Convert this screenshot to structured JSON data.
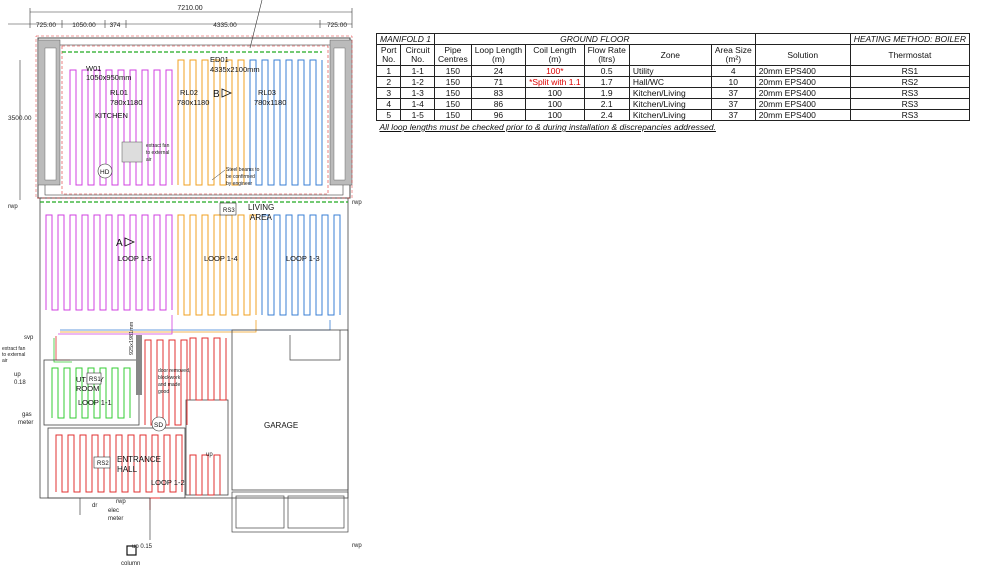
{
  "plan": {
    "dims": {
      "total_width": "7210.00",
      "left": "725.00",
      "seg1": "1050.00",
      "seg2": "374",
      "middle": "4335.00",
      "right": "725.00",
      "height": "3500.00"
    },
    "openings": {
      "w01_code": "W01",
      "w01_size": "1050x950mm",
      "ed01_code": "ED01",
      "ed01_size": "4335x2100mm",
      "rl01_code": "RL01",
      "rl01_size": "780x1180",
      "rl02_code": "RL02",
      "rl02_size": "780x1180",
      "rl03_code": "RL03",
      "rl03_size": "780x1180"
    },
    "labels": {
      "kitchen": "KITCHEN",
      "living": "LIVING",
      "area": "AREA",
      "utility": "UTILITY",
      "room": "ROOM",
      "entrance": "ENTRANCE",
      "hall": "HALL",
      "garage": "GARAGE",
      "loop_1_5": "LOOP 1-5",
      "loop_1_4": "LOOP 1-4",
      "loop_1_3": "LOOP 1-3",
      "loop_1_1": "LOOP 1-1",
      "loop_1_2": "LOOP 1-2",
      "rs1": "RS1",
      "rs2": "RS2",
      "rs3": "RS3",
      "hd": "HD",
      "sd": "SD",
      "section_a": "A",
      "section_b": "B",
      "rwp": "rwp",
      "svp": "svp",
      "gas": "gas",
      "meter": "meter",
      "up": "up",
      "up_val": "0.18",
      "up_015": "up 0.15",
      "dr": "dr",
      "elec": "elec",
      "elec_meter": "meter",
      "column": "column",
      "stair_up": "up",
      "extract_fan1": "extract fan",
      "extract_fan2": "to external",
      "extract_fan3": "air",
      "extract_fan_b1": "extract fan",
      "extract_fan_b2": "to external",
      "extract_fan_b3": "air",
      "steel1": "Steel beams to",
      "steel2": "be confirmed",
      "steel3": "by engineer",
      "door1": "door removed,",
      "door2": "blockwork",
      "door3": "and made",
      "door4": "good",
      "dim_vertical": "925x1981mm"
    }
  },
  "table": {
    "manifold": "MANIFOLD 1",
    "ground_floor": "GROUND FLOOR",
    "heating_method": "HEATING METHOD: BOILER",
    "headers": {
      "port": "Port",
      "port2": "No.",
      "circuit": "Circuit",
      "circuit2": "No.",
      "pipe": "Pipe",
      "pipe2": "Centres",
      "loop": "Loop Length",
      "loop2": "(m)",
      "coil": "Coil Length",
      "coil2": "(m)",
      "flow": "Flow Rate",
      "flow2": "(ltrs)",
      "zone": "Zone",
      "area": "Area Size",
      "area2": "(m²)",
      "solution": "Solution",
      "thermostat": "Thermostat"
    },
    "rows": [
      {
        "port": "1",
        "circuit": "1-1",
        "pipe": "150",
        "loop": "24",
        "coil": "100*",
        "flow": "0.5",
        "zone": "Utility",
        "area": "4",
        "solution": "20mm EPS400",
        "thermostat": "RS1"
      },
      {
        "port": "2",
        "circuit": "1-2",
        "pipe": "150",
        "loop": "71",
        "coil": "*Split with 1.1",
        "flow": "1.7",
        "zone": "Hall/WC",
        "area": "10",
        "solution": "20mm EPS400",
        "thermostat": "RS2"
      },
      {
        "port": "3",
        "circuit": "1-3",
        "pipe": "150",
        "loop": "83",
        "coil": "100",
        "flow": "1.9",
        "zone": "Kitchen/Living",
        "area": "37",
        "solution": "20mm EPS400",
        "thermostat": "RS3"
      },
      {
        "port": "4",
        "circuit": "1-4",
        "pipe": "150",
        "loop": "86",
        "coil": "100",
        "flow": "2.1",
        "zone": "Kitchen/Living",
        "area": "37",
        "solution": "20mm EPS400",
        "thermostat": "RS3"
      },
      {
        "port": "5",
        "circuit": "1-5",
        "pipe": "150",
        "loop": "96",
        "coil": "100",
        "flow": "2.4",
        "zone": "Kitchen/Living",
        "area": "37",
        "solution": "20mm EPS400",
        "thermostat": "RS3"
      }
    ],
    "note": "All loop lengths must be checked prior to & during installation & discrepancies addressed."
  },
  "colors": {
    "loop_1_1": "#33cc33",
    "loop_1_2": "#e03030",
    "loop_1_3": "#3a7fd5",
    "loop_1_4": "#f0a020",
    "loop_1_5": "#d040e0",
    "dashed_green": "#22aa22",
    "dashed_red": "#e03030"
  }
}
